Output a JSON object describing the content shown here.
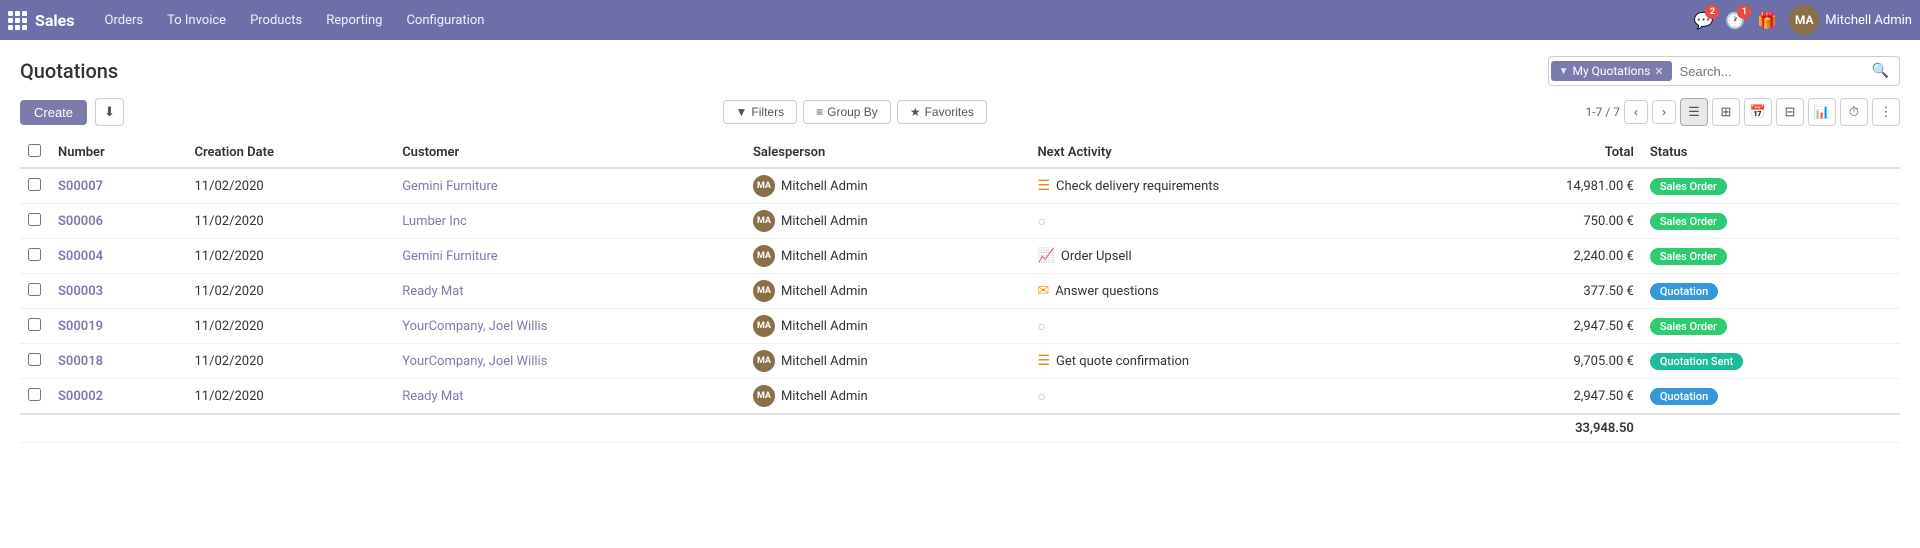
{
  "app": {
    "brand": "Sales",
    "grid_icon": "grid-icon"
  },
  "navbar": {
    "menu_items": [
      {
        "label": "Orders",
        "id": "orders"
      },
      {
        "label": "To Invoice",
        "id": "to-invoice"
      },
      {
        "label": "Products",
        "id": "products"
      },
      {
        "label": "Reporting",
        "id": "reporting"
      },
      {
        "label": "Configuration",
        "id": "configuration"
      }
    ],
    "user_name": "Mitchell Admin",
    "notification_count": "2",
    "message_count": "1"
  },
  "page": {
    "title": "Quotations"
  },
  "toolbar": {
    "create_label": "Create",
    "download_icon": "⬇",
    "filter_label": "Filters",
    "group_by_label": "Group By",
    "favorites_label": "Favorites"
  },
  "search": {
    "tag_label": "My Quotations",
    "placeholder": "Search..."
  },
  "pagination": {
    "info": "1-7 / 7"
  },
  "table": {
    "columns": [
      {
        "label": "",
        "id": "checkbox"
      },
      {
        "label": "Number",
        "id": "number"
      },
      {
        "label": "Creation Date",
        "id": "creation_date"
      },
      {
        "label": "Customer",
        "id": "customer"
      },
      {
        "label": "Salesperson",
        "id": "salesperson"
      },
      {
        "label": "Next Activity",
        "id": "next_activity"
      },
      {
        "label": "Total",
        "id": "total"
      },
      {
        "label": "Status",
        "id": "status"
      }
    ],
    "rows": [
      {
        "number": "S00007",
        "creation_date": "11/02/2020",
        "customer": "Gemini Furniture",
        "salesperson": "Mitchell Admin",
        "next_activity": "Check delivery requirements",
        "next_activity_icon": "list",
        "total": "14,981.00 €",
        "status": "Sales Order",
        "status_class": "status-sales-order"
      },
      {
        "number": "S00006",
        "creation_date": "11/02/2020",
        "customer": "Lumber Inc",
        "salesperson": "Mitchell Admin",
        "next_activity": "",
        "next_activity_icon": "circle",
        "total": "750.00 €",
        "status": "Sales Order",
        "status_class": "status-sales-order"
      },
      {
        "number": "S00004",
        "creation_date": "11/02/2020",
        "customer": "Gemini Furniture",
        "salesperson": "Mitchell Admin",
        "next_activity": "Order Upsell",
        "next_activity_icon": "trend",
        "total": "2,240.00 €",
        "status": "Sales Order",
        "status_class": "status-sales-order"
      },
      {
        "number": "S00003",
        "creation_date": "11/02/2020",
        "customer": "Ready Mat",
        "salesperson": "Mitchell Admin",
        "next_activity": "Answer questions",
        "next_activity_icon": "mail",
        "total": "377.50 €",
        "status": "Quotation",
        "status_class": "status-quotation"
      },
      {
        "number": "S00019",
        "creation_date": "11/02/2020",
        "customer": "YourCompany, Joel Willis",
        "salesperson": "Mitchell Admin",
        "next_activity": "",
        "next_activity_icon": "circle",
        "total": "2,947.50 €",
        "status": "Sales Order",
        "status_class": "status-sales-order"
      },
      {
        "number": "S00018",
        "creation_date": "11/02/2020",
        "customer": "YourCompany, Joel Willis",
        "salesperson": "Mitchell Admin",
        "next_activity": "Get quote confirmation",
        "next_activity_icon": "list",
        "total": "9,705.00 €",
        "status": "Quotation Sent",
        "status_class": "status-quotation-sent"
      },
      {
        "number": "S00002",
        "creation_date": "11/02/2020",
        "customer": "Ready Mat",
        "salesperson": "Mitchell Admin",
        "next_activity": "",
        "next_activity_icon": "circle",
        "total": "2,947.50 €",
        "status": "Quotation",
        "status_class": "status-quotation"
      }
    ],
    "grand_total": "33,948.50"
  },
  "colors": {
    "accent": "#6c6fa8",
    "brand": "#7c7bad"
  }
}
